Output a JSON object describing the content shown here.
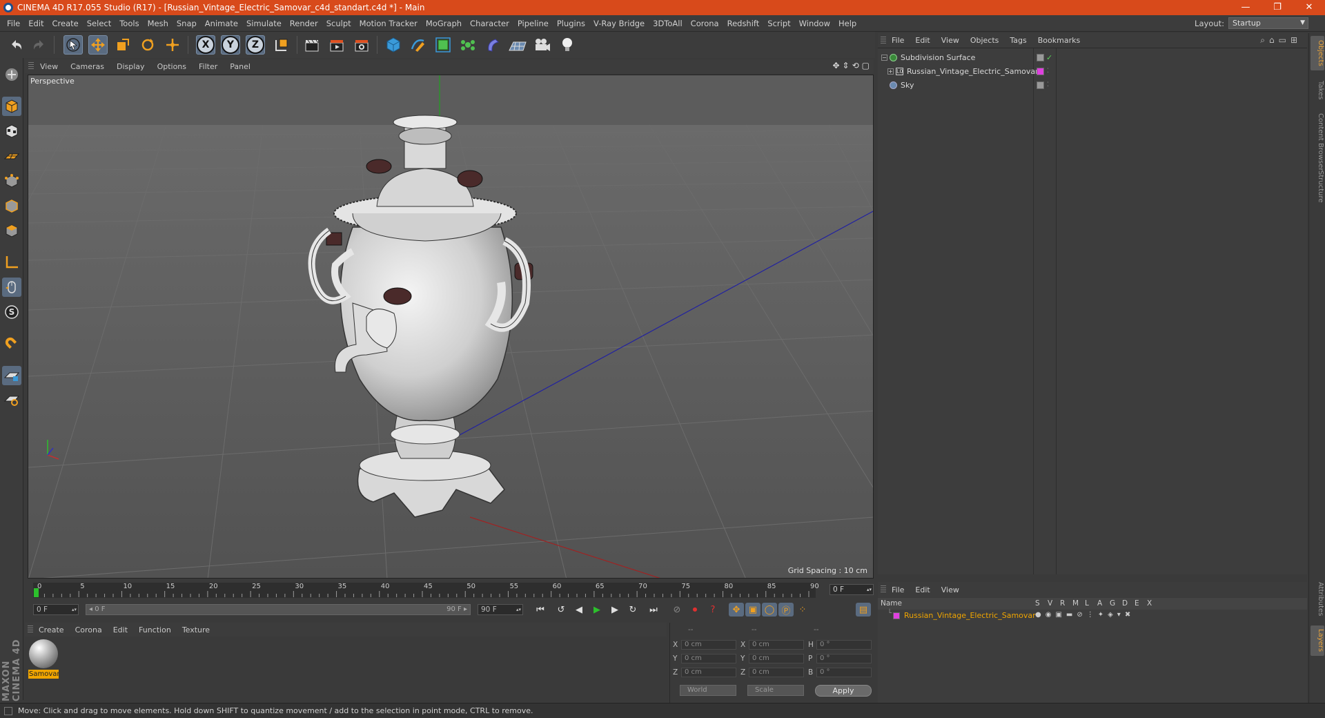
{
  "window": {
    "title": "CINEMA 4D R17.055 Studio (R17) - [Russian_Vintage_Electric_Samovar_c4d_standart.c4d *] - Main",
    "controls": [
      "—",
      "❐",
      "✕"
    ]
  },
  "menubar": {
    "items": [
      "File",
      "Edit",
      "Create",
      "Select",
      "Tools",
      "Mesh",
      "Snap",
      "Animate",
      "Simulate",
      "Render",
      "Sculpt",
      "Motion Tracker",
      "MoGraph",
      "Character",
      "Pipeline",
      "Plugins",
      "V-Ray Bridge",
      "3DToAll",
      "Corona",
      "Redshift",
      "Script",
      "Window",
      "Help"
    ],
    "layout_label": "Layout:",
    "layout_value": "Startup"
  },
  "toolbar": {
    "axis_x": "X",
    "axis_y": "Y",
    "axis_z": "Z"
  },
  "viewport": {
    "menu": [
      "View",
      "Cameras",
      "Display",
      "Options",
      "Filter",
      "Panel"
    ],
    "label": "Perspective",
    "grid_spacing": "Grid Spacing : 10 cm",
    "nav_icons": [
      "✥",
      "⇕",
      "⟲",
      "▢"
    ]
  },
  "timeline": {
    "ticks": [
      "0",
      "5",
      "10",
      "15",
      "20",
      "25",
      "30",
      "35",
      "40",
      "45",
      "50",
      "55",
      "60",
      "65",
      "70",
      "75",
      "80",
      "85",
      "90"
    ],
    "current_frame": "0 F",
    "start_field": "0 F",
    "range_start": "◂ 0 F",
    "range_end": "90 F ▸",
    "end_field": "90 F",
    "field_arrow": "▴▾"
  },
  "material_manager": {
    "menu": [
      "Create",
      "Corona",
      "Edit",
      "Function",
      "Texture"
    ],
    "material_name": "Samovar"
  },
  "coordinates": {
    "headers": [
      "--",
      "--",
      "--"
    ],
    "rows": [
      {
        "a": "X",
        "av": "0 cm",
        "b": "X",
        "bv": "0 cm",
        "c": "H",
        "cv": "0 °"
      },
      {
        "a": "Y",
        "av": "0 cm",
        "b": "Y",
        "bv": "0 cm",
        "c": "P",
        "cv": "0 °"
      },
      {
        "a": "Z",
        "av": "0 cm",
        "b": "Z",
        "bv": "0 cm",
        "c": "B",
        "cv": "0 °"
      }
    ],
    "mode": "World",
    "mode2": "Scale",
    "apply": "Apply"
  },
  "object_manager": {
    "menu": [
      "File",
      "Edit",
      "View",
      "Objects",
      "Tags",
      "Bookmarks"
    ],
    "objects": [
      {
        "name": "Subdivision Surface",
        "color": "#3a8a3a"
      },
      {
        "name": "Russian_Vintage_Electric_Samovar",
        "color": "#e040e0"
      },
      {
        "name": "Sky",
        "color": "#6a8ab0"
      }
    ]
  },
  "layer_manager": {
    "menu": [
      "File",
      "Edit",
      "View"
    ],
    "headers": {
      "name": "Name",
      "cols": [
        "S",
        "V",
        "R",
        "M",
        "L",
        "A",
        "G",
        "D",
        "E",
        "X"
      ]
    },
    "layers": [
      {
        "name": "Russian_Vintage_Electric_Samovar",
        "color": "#e040e0"
      }
    ]
  },
  "right_tabs": [
    "Objects",
    "Takes",
    "Content Browser",
    "Structure"
  ],
  "right_tabs_bottom": [
    "Attributes",
    "Layers"
  ],
  "brand": "MAXON CINEMA 4D",
  "status": "Move: Click and drag to move elements. Hold down SHIFT to quantize movement / add to the selection in point mode, CTRL to remove.",
  "colors": {
    "titlebar": "#d84a1b",
    "selection": "#f0a500",
    "axis_y": "#2cc02c",
    "axis_x": "#c03030",
    "axis_z": "#3030c0"
  }
}
